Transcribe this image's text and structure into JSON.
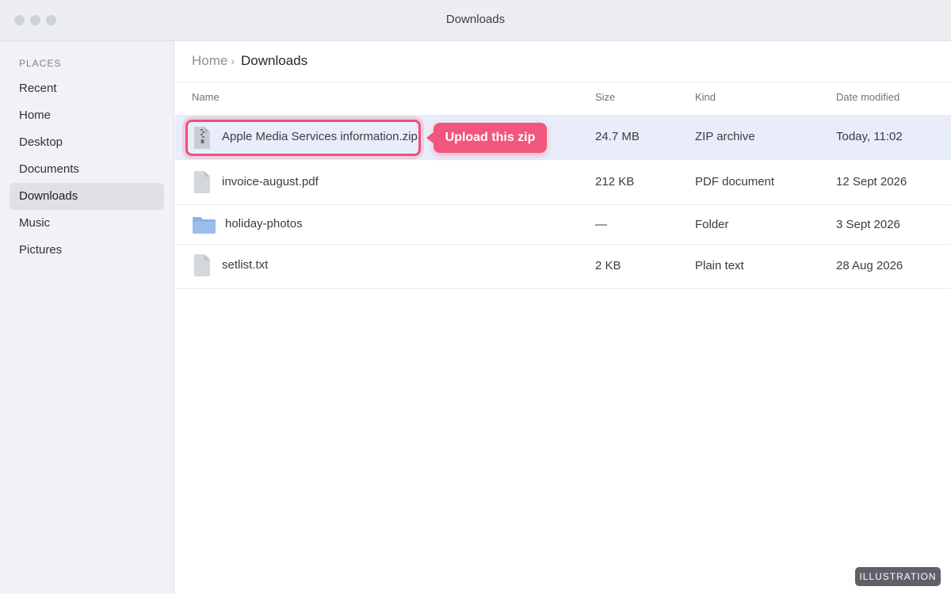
{
  "window": {
    "title": "Downloads"
  },
  "sidebar": {
    "heading": "PLACES",
    "items": [
      {
        "label": "Recent",
        "active": false
      },
      {
        "label": "Home",
        "active": false
      },
      {
        "label": "Desktop",
        "active": false
      },
      {
        "label": "Documents",
        "active": false
      },
      {
        "label": "Downloads",
        "active": true
      },
      {
        "label": "Music",
        "active": false
      },
      {
        "label": "Pictures",
        "active": false
      }
    ]
  },
  "breadcrumb": {
    "home": "Home",
    "separator": "›",
    "current": "Downloads"
  },
  "table": {
    "columns": {
      "name": "Name",
      "size": "Size",
      "kind": "Kind",
      "date": "Date modified"
    },
    "rows": [
      {
        "name": "Apple Media Services information.zip",
        "size": "24.7 MB",
        "kind": "ZIP archive",
        "date": "Today, 11:02",
        "icon": "zip-file-icon",
        "selected": true
      },
      {
        "name": "invoice-august.pdf",
        "size": "212 KB",
        "kind": "PDF document",
        "date": "12 Sept 2026",
        "icon": "document-icon",
        "selected": false
      },
      {
        "name": "holiday-photos",
        "size": "—",
        "kind": "Folder",
        "date": "3 Sept 2026",
        "icon": "folder-icon",
        "selected": false
      },
      {
        "name": "setlist.txt",
        "size": "2 KB",
        "kind": "Plain text",
        "date": "28 Aug 2026",
        "icon": "document-icon",
        "selected": false
      }
    ]
  },
  "callout": {
    "text": "Upload this zip",
    "color": "#f2557d"
  },
  "watermark": "ILLUSTRATION",
  "colors": {
    "accent": "#f04f79",
    "selected_row": "#e8edf9",
    "folder": "#8eb0ea"
  }
}
